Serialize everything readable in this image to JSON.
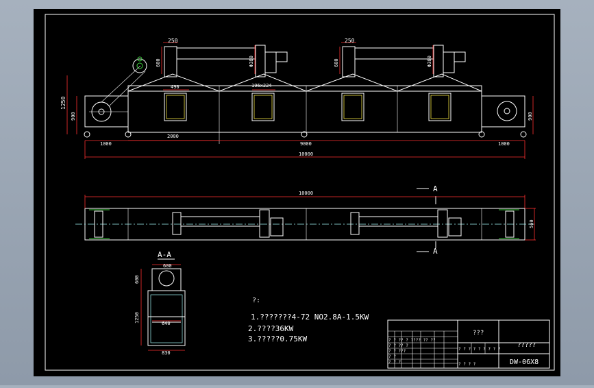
{
  "drawing": {
    "elevation_dims": {
      "d250_left": "250",
      "d250_right": "250",
      "d600_left": "600",
      "d600_right": "600",
      "d380_left": "Φ380",
      "d380_right": "Φ380",
      "d490": "490",
      "d196": "196x224",
      "d1250": "1250",
      "d900_left": "900",
      "d900_right": "900",
      "d1000_left": "1000",
      "d2000": "2000",
      "d9000": "9000",
      "d1000_right": "1000",
      "d10000": "10000"
    },
    "plan_dims": {
      "d10000": "10000",
      "d500": "500",
      "section_mark_top": "A",
      "section_mark_bottom": "A"
    },
    "section": {
      "title": "A-A",
      "d600_top": "600",
      "d600_left": "600",
      "d1250": "1250",
      "d640": "640",
      "d830": "830"
    },
    "notes": {
      "heading": "?:",
      "line1": "1.???????4-72  NO2.8A-1.5KW",
      "line2": "2.????36KW",
      "line3": "3.?????0.75KW"
    },
    "title_block": {
      "name_cell": "???",
      "company_cell": "?????",
      "drawing_no": "DW-06X8",
      "small_row1": "? ? ?? ? ???? ?? ??",
      "small_row2": "? ? ?? ?",
      "small_row3": "? ? ???",
      "small_row4": "? ?",
      "small_row5": "? ? ?",
      "scale_cells": "? ? ? ?  ? ? ?  ? ?",
      "bottom_cells": "?  ?     ?  ?"
    }
  }
}
